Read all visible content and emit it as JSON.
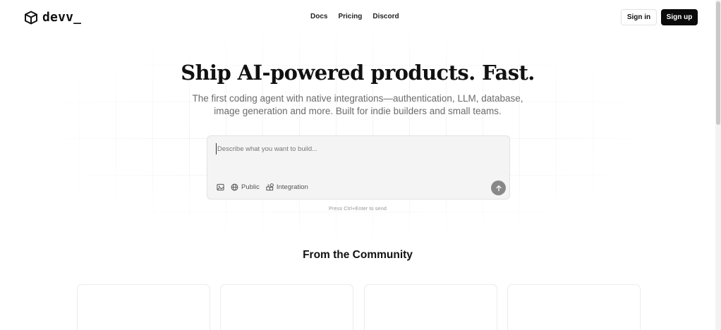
{
  "header": {
    "logo_text": "devv_",
    "nav": [
      "Docs",
      "Pricing",
      "Discord"
    ],
    "sign_in_label": "Sign in",
    "sign_up_label": "Sign up"
  },
  "hero": {
    "title": "Ship AI-powered products. Fast.",
    "subtitle_line1": "The first coding agent with native integrations—authentication, LLM, database,",
    "subtitle_line2": "image generation and more. Built for indie builders and small teams."
  },
  "prompt": {
    "placeholder": "Describe what you want to build...",
    "value": "",
    "image_icon": "image-icon",
    "visibility_label": "Public",
    "integration_label": "Integration",
    "send_icon": "arrow-up-icon",
    "hint": "Press Ctrl+Enter to send"
  },
  "community": {
    "title": "From the Community",
    "cards": [
      "",
      "",
      "",
      ""
    ]
  },
  "colors": {
    "primary": "#0b0b0b",
    "muted_text": "#6b6b6b",
    "prompt_bg": "#f4f4f4",
    "send_button": "#888888"
  }
}
